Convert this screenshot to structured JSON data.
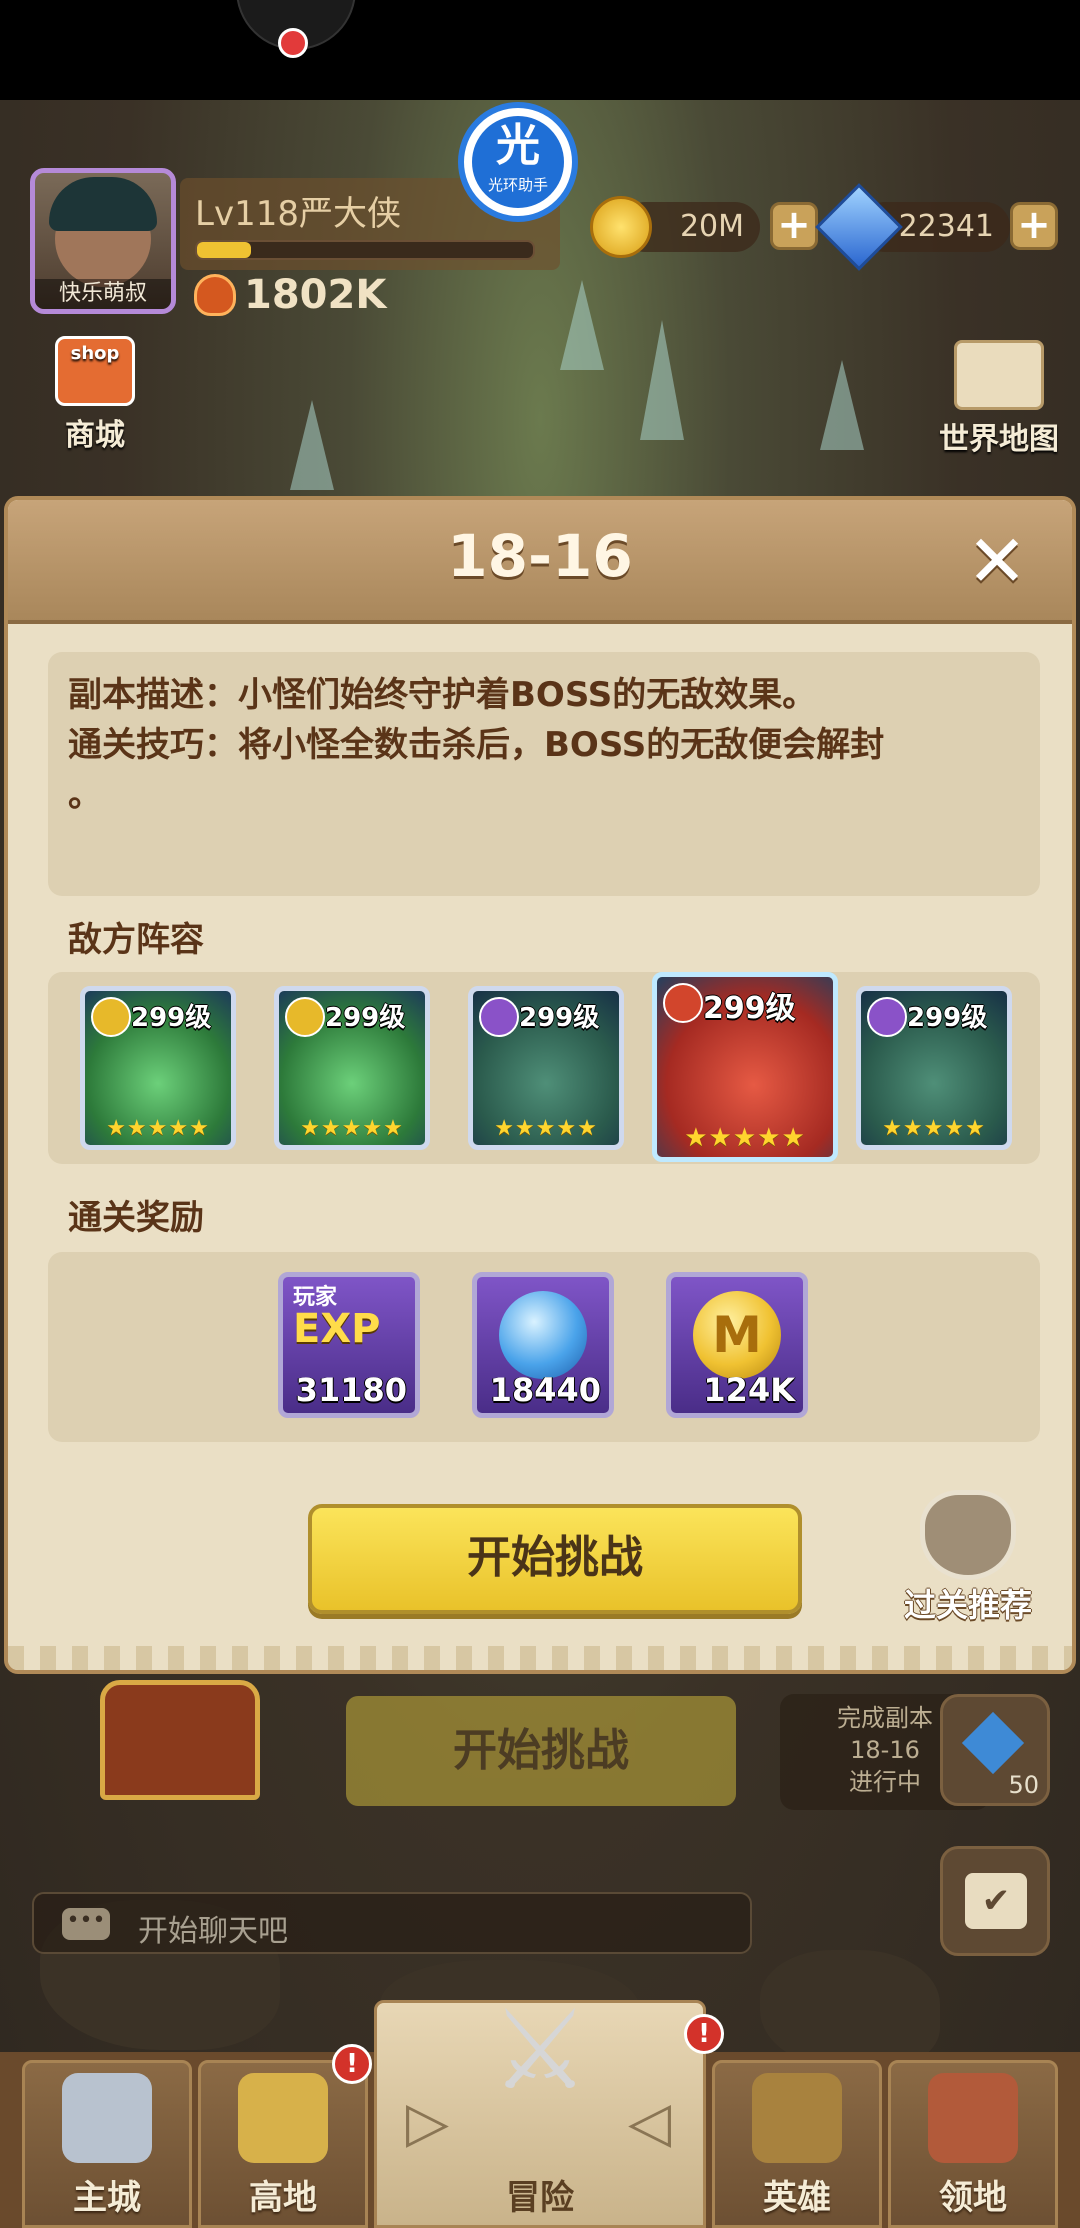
{
  "player": {
    "level_name": "Lv118严大侠",
    "avatar_label": "快乐萌叔",
    "power": "1802K",
    "exp_progress": 0.16
  },
  "resources": {
    "gold": "20M",
    "diamonds": "22341"
  },
  "assistant": {
    "char": "光",
    "label": "光环助手"
  },
  "side": {
    "shop_icon_text": "shop",
    "shop_label": "商城",
    "map_label": "世界地图"
  },
  "dialog": {
    "title": "18-16",
    "close_glyph": "✕",
    "description_line1": "副本描述：小怪们始终守护着BOSS的无敌效果。",
    "description_line2": "通关技巧：将小怪全数击杀后，BOSS的无敌便会解封",
    "description_line3": "。",
    "enemy_section": "敌方阵容",
    "enemies": [
      {
        "level": "299级",
        "stars": "★★★★★",
        "badge": "shield",
        "color": "#3fae54"
      },
      {
        "level": "299级",
        "stars": "★★★★★",
        "badge": "shield",
        "color": "#3fae54"
      },
      {
        "level": "299级",
        "stars": "★★★★★",
        "badge": "book",
        "color": "#2f6a58"
      },
      {
        "level": "299级",
        "stars": "★★★★★",
        "badge": "axe",
        "color": "#cf3b2c"
      },
      {
        "level": "299级",
        "stars": "★★★★★",
        "badge": "book",
        "color": "#2f6a58"
      }
    ],
    "reward_section": "通关奖励",
    "rewards": [
      {
        "icon": "exp-icon",
        "top_text": "玩家",
        "main_text": "EXP",
        "value": "31180"
      },
      {
        "icon": "spirit-orb-icon",
        "value": "18440"
      },
      {
        "icon": "gold-coin-icon",
        "coin_letter": "M",
        "value": "124K"
      }
    ],
    "start_label": "开始挑战",
    "recommend_label": "过关推荐"
  },
  "background": {
    "start_label": "开始挑战",
    "quest_line1": "完成副本",
    "quest_line2": "18-16",
    "quest_line3": "进行中",
    "quest_reward_count": "50",
    "chat_icon": "•••",
    "chat_placeholder": "开始聊天吧",
    "calendar_glyph": "✔"
  },
  "nav": {
    "tabs": [
      "主城",
      "高地",
      "冒险",
      "英雄",
      "领地"
    ],
    "badge_glyph": "!",
    "arrow_left": "▷",
    "arrow_right": "◁",
    "swords_glyph": "⚔"
  },
  "colors": {
    "accent_gold": "#f0c232",
    "dialog_bg": "#eadfc5",
    "start_btn": "#fbe45a",
    "text_brown": "#5a3418"
  }
}
